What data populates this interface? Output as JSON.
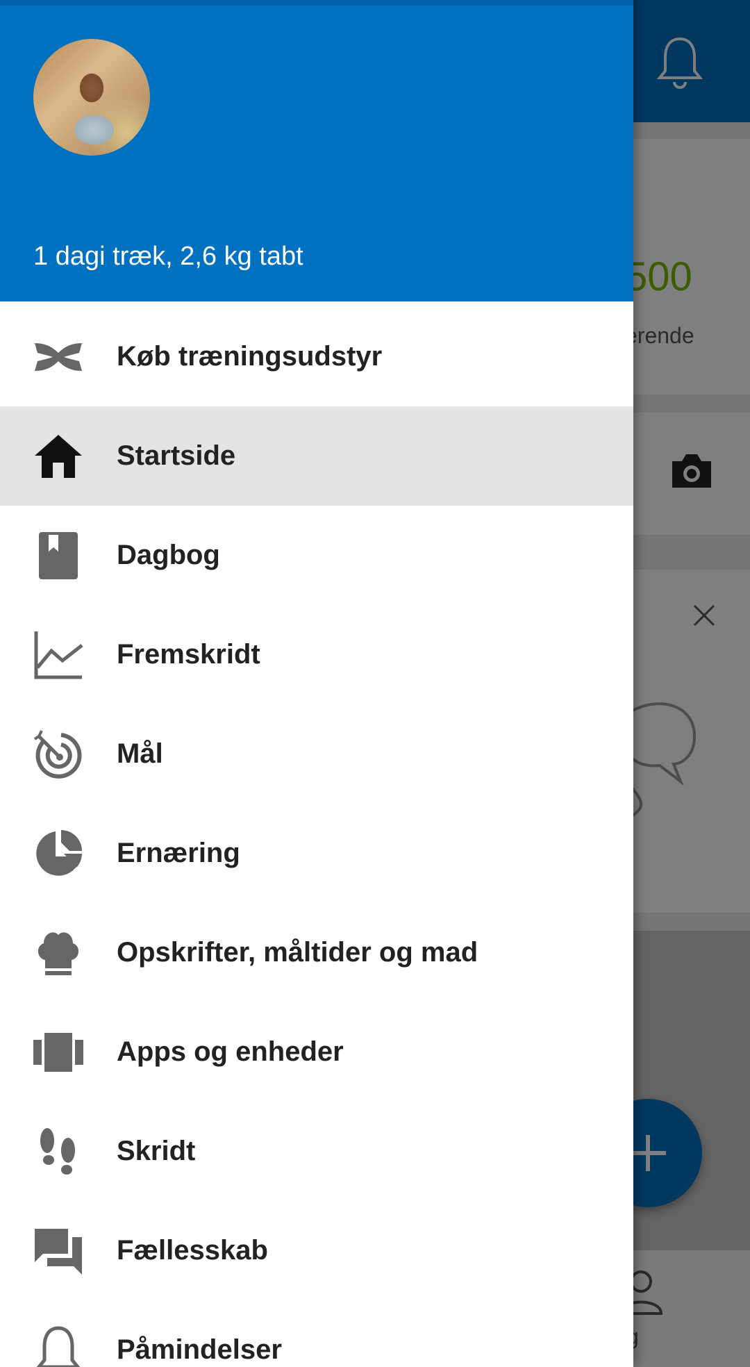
{
  "drawer": {
    "streak_text": "1 dagi træk, 2,6 kg tabt",
    "items": [
      {
        "label": "Køb træningsudstyr",
        "icon": "under-armour-logo-icon",
        "selected": false
      },
      {
        "label": "Startside",
        "icon": "home-icon",
        "selected": true
      },
      {
        "label": "Dagbog",
        "icon": "diary-book-icon",
        "selected": false
      },
      {
        "label": "Fremskridt",
        "icon": "progress-chart-icon",
        "selected": false
      },
      {
        "label": "Mål",
        "icon": "target-icon",
        "selected": false
      },
      {
        "label": "Ernæring",
        "icon": "pie-chart-icon",
        "selected": false
      },
      {
        "label": "Opskrifter, måltider og mad",
        "icon": "chef-hat-icon",
        "selected": false
      },
      {
        "label": "Apps og enheder",
        "icon": "apps-devices-icon",
        "selected": false
      },
      {
        "label": "Skridt",
        "icon": "footprints-icon",
        "selected": false
      },
      {
        "label": "Fællesskab",
        "icon": "community-chat-icon",
        "selected": false
      },
      {
        "label": "Påmindelser",
        "icon": "reminder-bell-icon",
        "selected": false
      }
    ]
  },
  "background": {
    "calorie_value": "500",
    "calorie_sub": "erende",
    "nav_label": "g"
  },
  "colors": {
    "brand_blue": "#0070c0",
    "selected_row": "#e4e4e4",
    "icon_gray": "#666666",
    "accent_green": "#7ab800"
  }
}
